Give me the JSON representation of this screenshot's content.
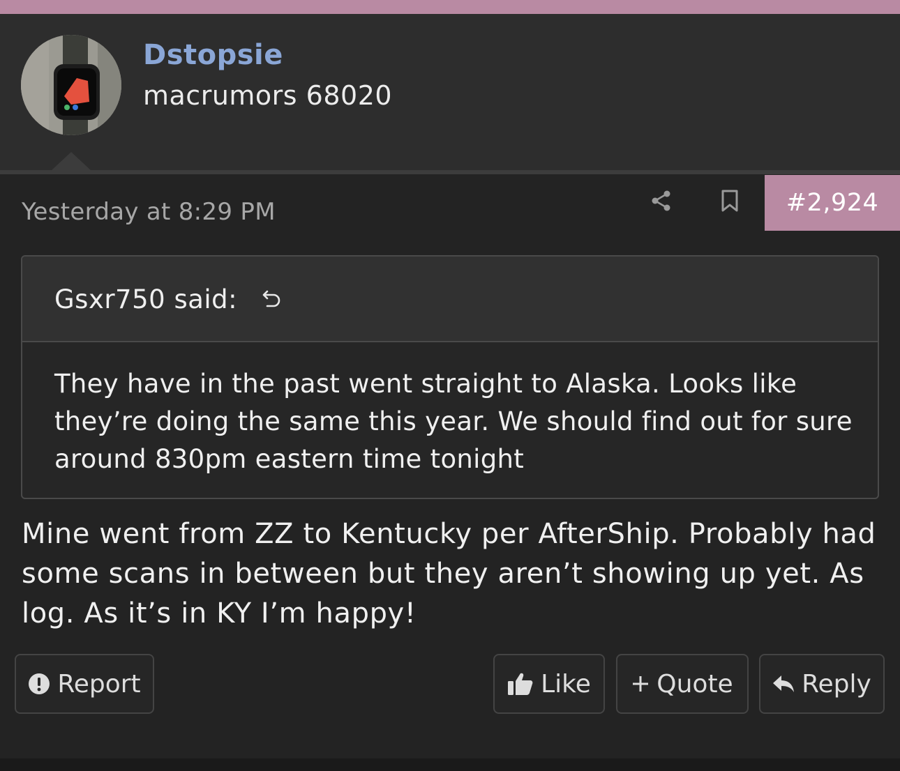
{
  "user": {
    "name": "Dstopsie",
    "title": "macrumors 68020"
  },
  "post": {
    "date": "Yesterday at 8:29 PM",
    "number": "#2,924",
    "body": "Mine went from ZZ to Kentucky per AfterShip. Probably had some scans in between but they aren’t showing up yet. As log. As it’s in KY I’m happy!"
  },
  "quote": {
    "author_label": "Gsxr750 said:",
    "text": "They have in the past went straight to Alaska. Looks like they’re doing the same this year. We should find out for sure around 830pm eastern time tonight"
  },
  "actions": {
    "report": "Report",
    "like": "Like",
    "quote": "Quote",
    "reply": "Reply"
  },
  "icons": {
    "share": "share-icon",
    "bookmark": "bookmark-icon",
    "quote_return": "return-arrow-icon",
    "report": "exclamation-circle-icon",
    "like": "thumbs-up-icon",
    "quote": "plus-icon",
    "reply": "reply-arrow-icon"
  },
  "colors": {
    "accent": "#b98aa3",
    "username": "#8aa6d6",
    "background": "#232323",
    "header_background": "#2d2d2d"
  }
}
